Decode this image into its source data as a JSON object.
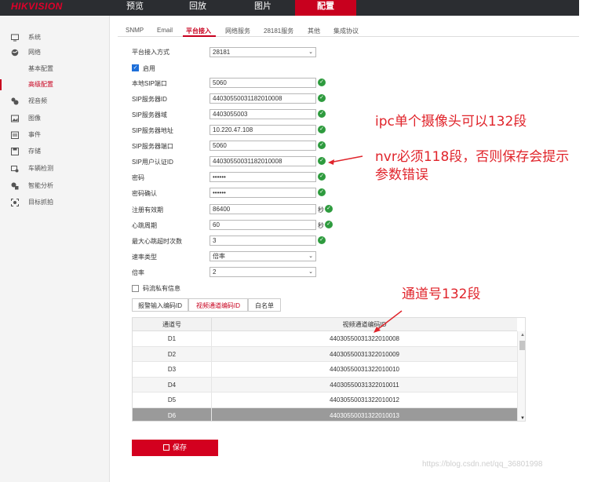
{
  "topbar": {
    "logo": "HIKVISION",
    "nav": [
      "预览",
      "回放",
      "图片",
      "配置"
    ],
    "active_nav": "配置"
  },
  "sidebar": {
    "items": [
      {
        "label": "系统",
        "icon": "monitor-icon"
      },
      {
        "label": "网络",
        "icon": "globe-icon"
      },
      {
        "label": "基本配置",
        "sub": true
      },
      {
        "label": "高级配置",
        "sub": true,
        "active": true
      },
      {
        "label": "视音频",
        "icon": "av-icon"
      },
      {
        "label": "图像",
        "icon": "image-icon"
      },
      {
        "label": "事件",
        "icon": "event-icon"
      },
      {
        "label": "存储",
        "icon": "storage-icon"
      },
      {
        "label": "车辆检测",
        "icon": "vehicle-icon"
      },
      {
        "label": "智能分析",
        "icon": "analysis-icon"
      },
      {
        "label": "目标抓拍",
        "icon": "capture-icon"
      }
    ]
  },
  "tabs": [
    "SNMP",
    "Email",
    "平台接入",
    "网络服务",
    "28181服务",
    "其他",
    "集成协议"
  ],
  "active_tab": "平台接入",
  "form": {
    "access_mode_label": "平台接入方式",
    "access_mode_value": "28181",
    "enable_label": "启用",
    "fields": [
      {
        "label": "本地SIP端口",
        "value": "5060"
      },
      {
        "label": "SIP服务器ID",
        "value": "44030550031182010008"
      },
      {
        "label": "SIP服务器域",
        "value": "4403055003"
      },
      {
        "label": "SIP服务器地址",
        "value": "10.220.47.108"
      },
      {
        "label": "SIP服务器端口",
        "value": "5060"
      },
      {
        "label": "SIP用户认证ID",
        "value": "44030550031182010008"
      },
      {
        "label": "密码",
        "value": "••••••"
      },
      {
        "label": "密码确认",
        "value": "••••••"
      },
      {
        "label": "注册有效期",
        "value": "86400",
        "unit": "秒"
      },
      {
        "label": "心跳周期",
        "value": "60",
        "unit": "秒"
      },
      {
        "label": "最大心跳超时次数",
        "value": "3"
      }
    ],
    "stream_type_label": "速率类型",
    "stream_type_value": "倍率",
    "rate_label": "倍率",
    "rate_value": "2",
    "encrypt_label": "码流私有信息"
  },
  "subtabs": [
    "报警输入编码ID",
    "视频通道编码ID",
    "白名单"
  ],
  "active_subtab": "视频通道编码ID",
  "table": {
    "headers": [
      "通道号",
      "视频通道编码ID"
    ],
    "rows": [
      [
        "D1",
        "44030550031322010008"
      ],
      [
        "D2",
        "44030550031322010009"
      ],
      [
        "D3",
        "44030550031322010010"
      ],
      [
        "D4",
        "44030550031322010011"
      ],
      [
        "D5",
        "44030550031322010012"
      ],
      [
        "D6",
        "44030550031322010013"
      ]
    ],
    "selected_row": 5
  },
  "save_label": "保存",
  "annotations": {
    "ipc": "ipc单个摄像头可以132段",
    "nvr_line1": "nvr必须118段，否则保存会提示",
    "nvr_line2": "参数错误",
    "channel": "通道号132段"
  },
  "watermark": "https://blog.csdn.net/qq_36801998",
  "colors": {
    "accent": "#c8001e",
    "topbar": "#2b2d31",
    "ok": "#2e9b3e",
    "annotation": "#e0242b"
  }
}
